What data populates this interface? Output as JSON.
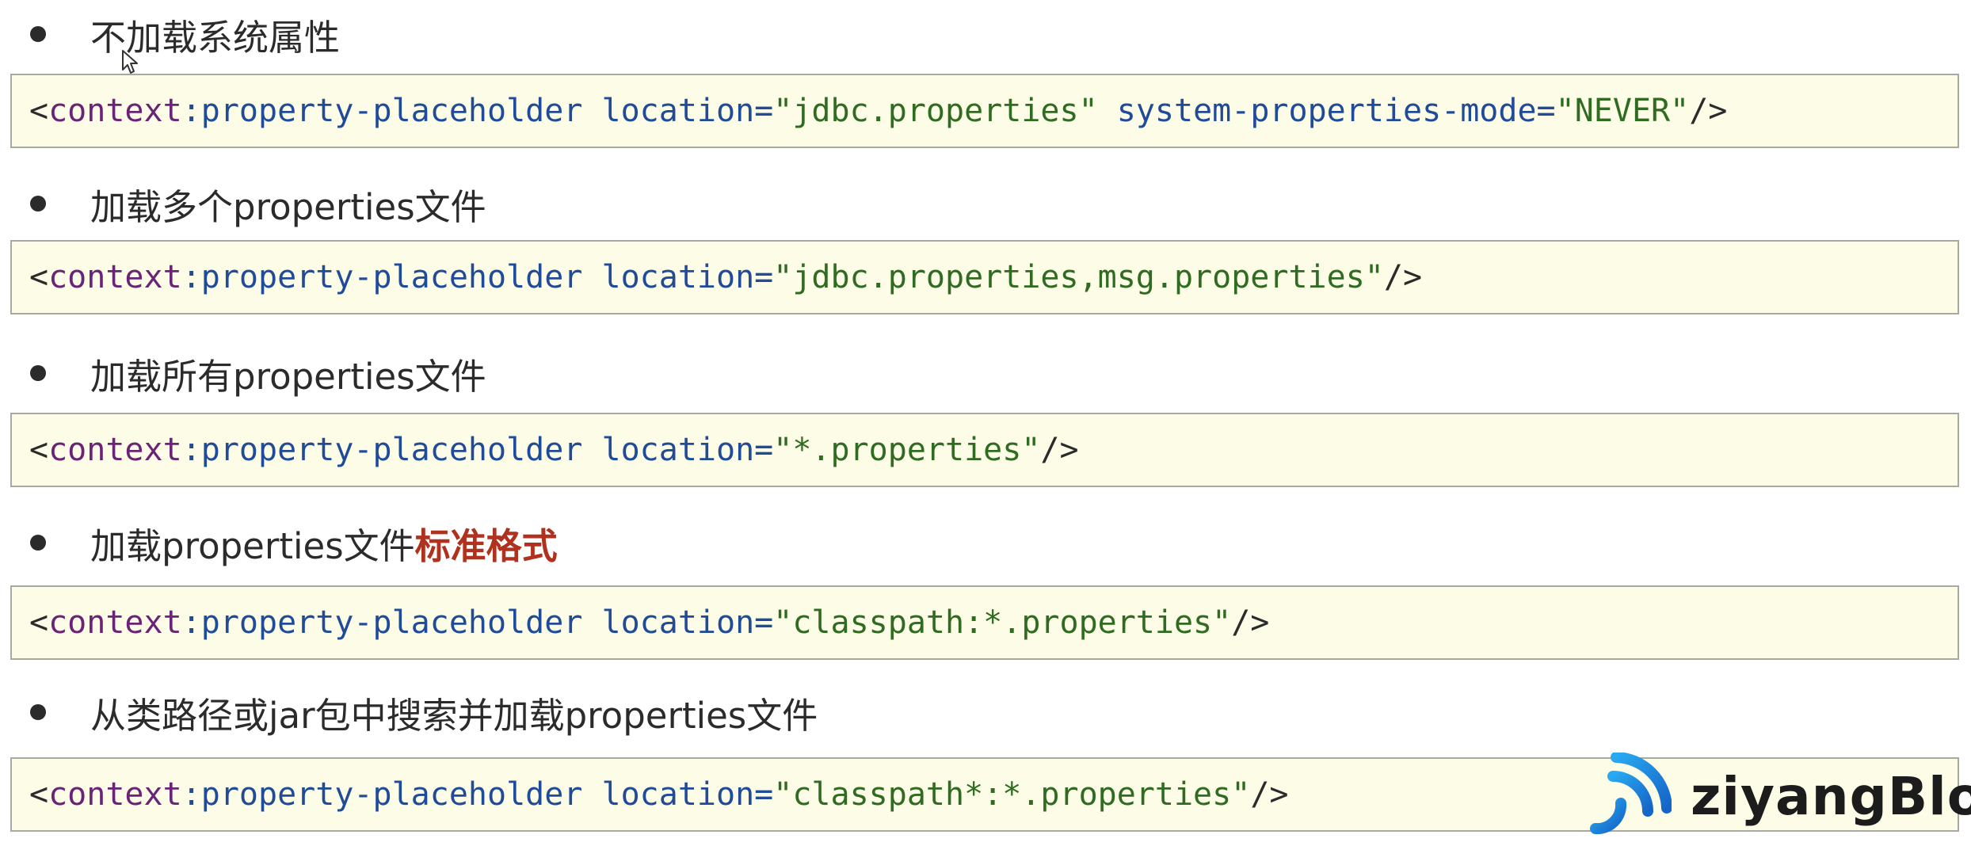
{
  "sections": [
    {
      "bullet": "不加载系统属性",
      "emphasis": "",
      "code": {
        "open": "<",
        "ns": "context",
        "colon": ":",
        "tag": "property-placeholder",
        "space1": " ",
        "attr1": "location=",
        "val1": "\"jdbc.properties\"",
        "space2": " ",
        "attr2": "system-properties-mode=",
        "val2": "\"NEVER\"",
        "close": "/>"
      }
    },
    {
      "bullet": "加载多个properties文件",
      "emphasis": "",
      "code": {
        "open": "<",
        "ns": "context",
        "colon": ":",
        "tag": "property-placeholder",
        "space1": " ",
        "attr1": "location=",
        "val1": "\"jdbc.properties,msg.properties\"",
        "close": "/>"
      }
    },
    {
      "bullet": "加载所有properties文件",
      "emphasis": "",
      "code": {
        "open": "<",
        "ns": "context",
        "colon": ":",
        "tag": "property-placeholder",
        "space1": " ",
        "attr1": "location=",
        "val1": "\"*.properties\"",
        "close": "/>"
      }
    },
    {
      "bullet": "加载properties文件",
      "emphasis": "标准格式",
      "code": {
        "open": "<",
        "ns": "context",
        "colon": ":",
        "tag": "property-placeholder",
        "space1": " ",
        "attr1": "location=",
        "val1": "\"classpath:*.properties\"",
        "close": "/>"
      }
    },
    {
      "bullet": "从类路径或jar包中搜索并加载properties文件",
      "emphasis": "",
      "code": {
        "open": "<",
        "ns": "context",
        "colon": ":",
        "tag": "property-placeholder",
        "space1": " ",
        "attr1": "location=",
        "val1": "\"classpath*:*.properties\"",
        "close": "/>"
      }
    }
  ],
  "watermark": {
    "text": "ziyangBlog",
    "icon": "wifi-signal-logo-icon"
  },
  "cursor": {
    "icon": "mouse-pointer-icon"
  },
  "colors": {
    "code_background": "#fdfce6",
    "namespace": "#6a2377",
    "tag_and_attr": "#1f4b99",
    "value": "#2f6b20",
    "emphasis": "#b0311e",
    "logo_blue": "#1e8fe0"
  }
}
